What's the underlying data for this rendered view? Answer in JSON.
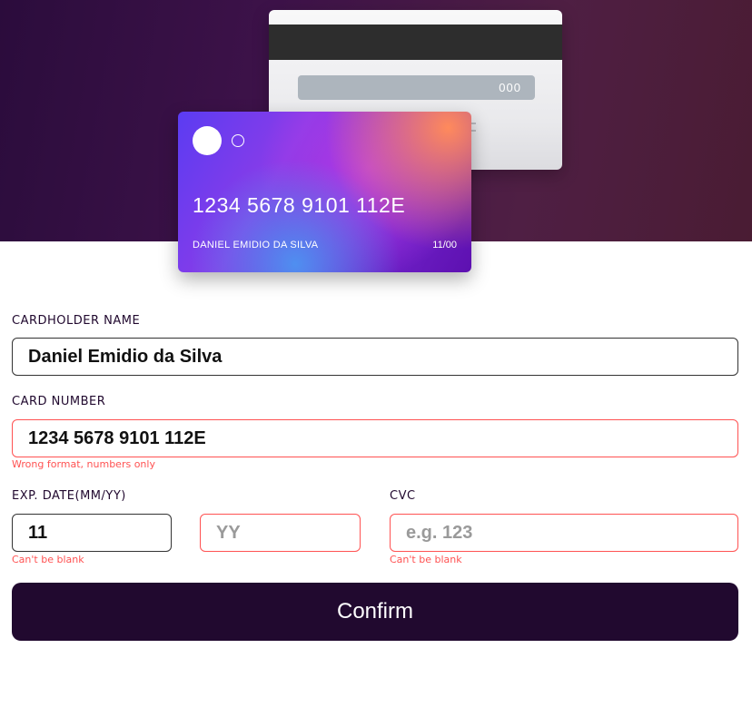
{
  "card": {
    "back_cvc": "000",
    "number": "1234 5678 9101 112E",
    "holder": "DANIEL EMIDIO DA SILVA",
    "expiry": "11/00"
  },
  "form": {
    "cardholder": {
      "label": "CARDHOLDER NAME",
      "value": "Daniel Emidio da Silva"
    },
    "number": {
      "label": "CARD NUMBER",
      "value": "1234 5678 9101 112E",
      "error": "Wrong format, numbers only"
    },
    "expiry": {
      "label": "EXP. DATE(MM/YY)",
      "month_value": "11",
      "year_placeholder": "YY",
      "error": "Can't be blank"
    },
    "cvc": {
      "label": "CVC",
      "placeholder": "e.g. 123",
      "error": "Can't be blank"
    },
    "confirm_label": "Confirm"
  },
  "colors": {
    "error": "#ff5252",
    "dark_violet": "#21092f"
  }
}
